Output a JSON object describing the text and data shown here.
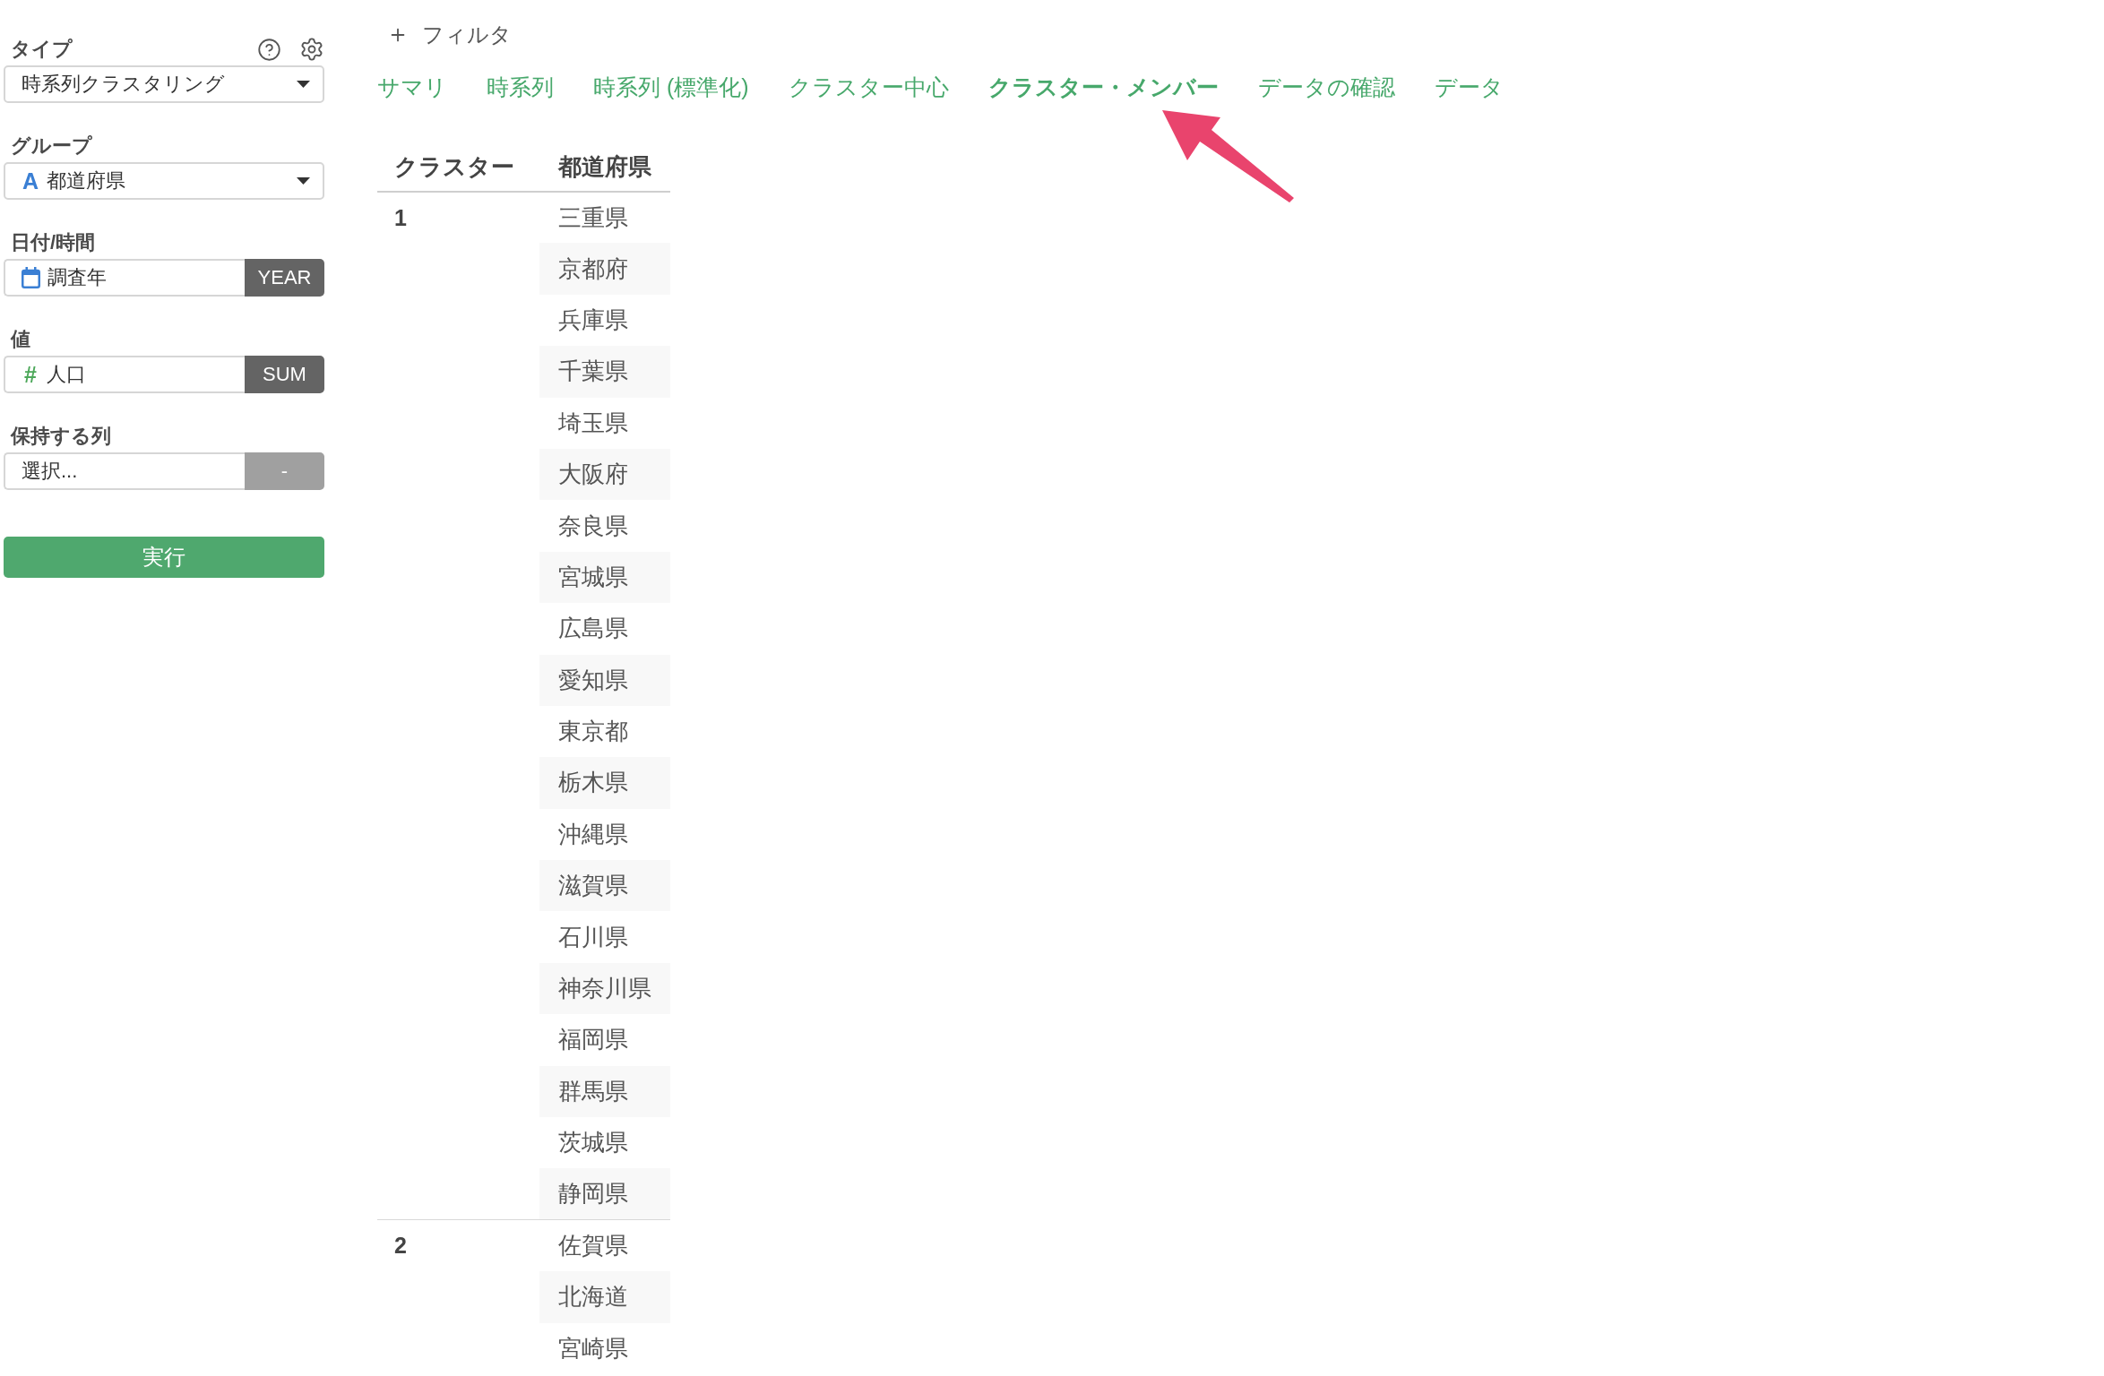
{
  "sidebar": {
    "fields": [
      {
        "kind": "select",
        "label": "タイプ",
        "value": "時系列クラスタリング"
      },
      {
        "kind": "text-column",
        "label": "グループ",
        "type_glyph": "A",
        "value": "都道府県"
      },
      {
        "kind": "date-column",
        "label": "日付/時間",
        "value": "調査年",
        "button": {
          "label": "YEAR",
          "disabled": false
        }
      },
      {
        "kind": "number-column",
        "label": "値",
        "type_glyph": "#",
        "value": "人口",
        "button": {
          "label": "SUM",
          "disabled": false
        }
      },
      {
        "kind": "multi-select",
        "label": "保持する列",
        "placeholder": "選択...",
        "button": {
          "label": "-",
          "disabled": true
        }
      }
    ],
    "run_button": {
      "label": "実行"
    }
  },
  "filter_button": {
    "label": "フィルタ"
  },
  "tabs": [
    {
      "label": "サマリ",
      "selected": false
    },
    {
      "label": "時系列",
      "selected": false
    },
    {
      "label": "時系列 (標準化)",
      "selected": false
    },
    {
      "label": "クラスター中心",
      "selected": false
    },
    {
      "label": "クラスター・メンバー",
      "selected": true
    },
    {
      "label": "データの確認",
      "selected": false
    },
    {
      "label": "データ",
      "selected": false
    }
  ],
  "table": {
    "columns": [
      "クラスター",
      "都道府県"
    ],
    "groups": [
      {
        "cluster": "1",
        "members": [
          "三重県",
          "京都府",
          "兵庫県",
          "千葉県",
          "埼玉県",
          "大阪府",
          "奈良県",
          "宮城県",
          "広島県",
          "愛知県",
          "東京都",
          "栃木県",
          "沖縄県",
          "滋賀県",
          "石川県",
          "神奈川県",
          "福岡県",
          "群馬県",
          "茨城県",
          "静岡県"
        ]
      },
      {
        "cluster": "2",
        "members": [
          "佐賀県",
          "北海道",
          "宮崎県"
        ]
      }
    ]
  }
}
